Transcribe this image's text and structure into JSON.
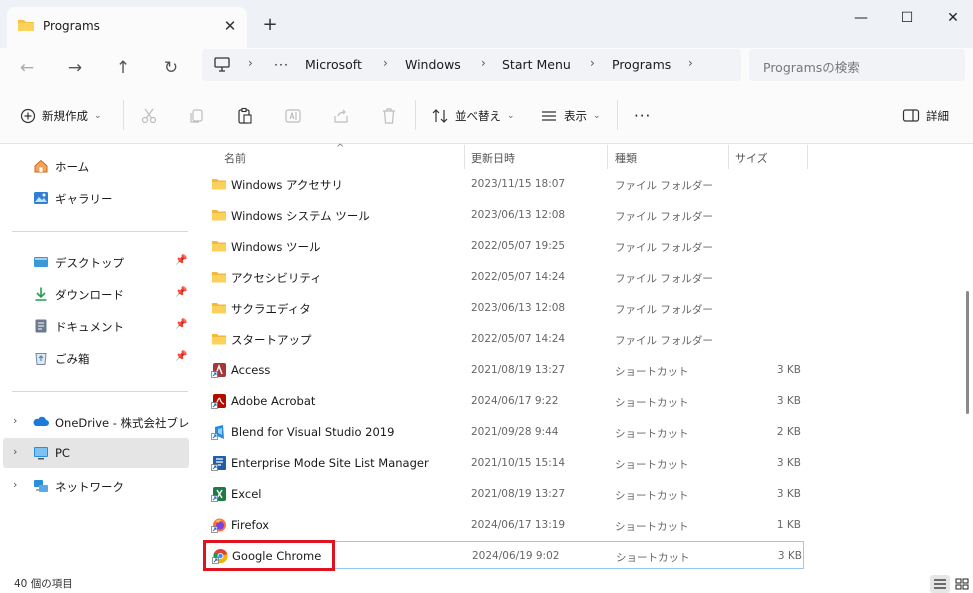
{
  "window": {
    "tab_title": "Programs",
    "tab_close": "✕",
    "new_tab": "+",
    "minimize": "—",
    "maximize": "☐",
    "close": "✕"
  },
  "navigation": {
    "back": "←",
    "forward": "→",
    "up": "↑",
    "refresh": "↻",
    "more_crumbs": "···",
    "breadcrumbs": [
      "Microsoft",
      "Windows",
      "Start Menu",
      "Programs"
    ],
    "search_placeholder": "Programsの検索"
  },
  "toolbar": {
    "new_label": "新規作成",
    "sort_label": "並べ替え",
    "view_label": "表示",
    "more_label": "···",
    "details_label": "詳細"
  },
  "sidebar": {
    "items": [
      {
        "label": "ホーム",
        "icon": "home-icon"
      },
      {
        "label": "ギャラリー",
        "icon": "gallery-icon"
      },
      {
        "label": "デスクトップ",
        "icon": "desktop-icon"
      },
      {
        "label": "ダウンロード",
        "icon": "download-icon"
      },
      {
        "label": "ドキュメント",
        "icon": "documents-icon"
      },
      {
        "label": "ごみ箱",
        "icon": "recycle-bin-icon"
      },
      {
        "label": "OneDrive - 株式会社ブレイン",
        "icon": "onedrive-icon"
      },
      {
        "label": "PC",
        "icon": "pc-icon"
      },
      {
        "label": "ネットワーク",
        "icon": "network-icon"
      }
    ]
  },
  "columns": {
    "name": "名前",
    "date": "更新日時",
    "type": "種類",
    "size": "サイズ"
  },
  "files": [
    {
      "name": "Windows アクセサリ",
      "date": "2023/11/15 18:07",
      "type": "ファイル フォルダー",
      "size": ""
    },
    {
      "name": "Windows システム ツール",
      "date": "2023/06/13 12:08",
      "type": "ファイル フォルダー",
      "size": ""
    },
    {
      "name": "Windows ツール",
      "date": "2022/05/07 19:25",
      "type": "ファイル フォルダー",
      "size": ""
    },
    {
      "name": "アクセシビリティ",
      "date": "2022/05/07 14:24",
      "type": "ファイル フォルダー",
      "size": ""
    },
    {
      "name": "サクラエディタ",
      "date": "2023/06/13 12:08",
      "type": "ファイル フォルダー",
      "size": ""
    },
    {
      "name": "スタートアップ",
      "date": "2022/05/07 14:24",
      "type": "ファイル フォルダー",
      "size": ""
    },
    {
      "name": "Access",
      "date": "2021/08/19 13:27",
      "type": "ショートカット",
      "size": "3 KB"
    },
    {
      "name": "Adobe Acrobat",
      "date": "2024/06/17 9:22",
      "type": "ショートカット",
      "size": "3 KB"
    },
    {
      "name": "Blend for Visual Studio 2019",
      "date": "2021/09/28 9:44",
      "type": "ショートカット",
      "size": "2 KB"
    },
    {
      "name": "Enterprise Mode Site List Manager",
      "date": "2021/10/15 15:14",
      "type": "ショートカット",
      "size": "3 KB"
    },
    {
      "name": "Excel",
      "date": "2021/08/19 13:27",
      "type": "ショートカット",
      "size": "3 KB"
    },
    {
      "name": "Firefox",
      "date": "2024/06/17 13:19",
      "type": "ショートカット",
      "size": "1 KB"
    },
    {
      "name": "Google Chrome",
      "date": "2024/06/19 9:02",
      "type": "ショートカット",
      "size": "3 KB"
    }
  ],
  "status": {
    "item_count": "40 個の項目"
  },
  "colors": {
    "folder": "#f5c242",
    "highlight": "#e0141e",
    "selection": "#e5e5e5",
    "focus_border": "#99c9ef"
  }
}
